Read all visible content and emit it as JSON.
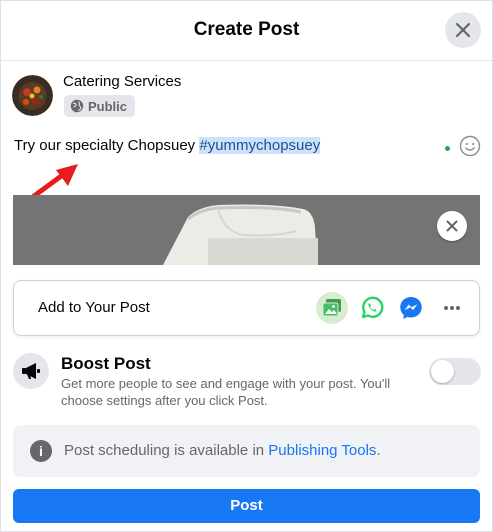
{
  "header": {
    "title": "Create Post"
  },
  "author": {
    "name": "Catering Services",
    "audience": "Public"
  },
  "composer": {
    "text": "Try our specialty Chopsuey ",
    "hashtag": "#yummychopsuey"
  },
  "add_to_post": {
    "label": "Add to Your Post",
    "icons": [
      "photo-video-icon",
      "whatsapp-icon",
      "messenger-icon",
      "more-icon"
    ]
  },
  "boost": {
    "title": "Boost Post",
    "description": "Get more people to see and engage with your post. You'll choose settings after you click Post.",
    "enabled": false
  },
  "info": {
    "text": "Post scheduling is available in ",
    "link": "Publishing Tools",
    "suffix": "."
  },
  "submit": {
    "label": "Post"
  },
  "colors": {
    "accent": "#1877f2",
    "hashtag_highlight": "#cfe2fb",
    "whatsapp": "#25d366",
    "status_dot": "#31a24c",
    "annotation_arrow": "#e41e1e"
  }
}
